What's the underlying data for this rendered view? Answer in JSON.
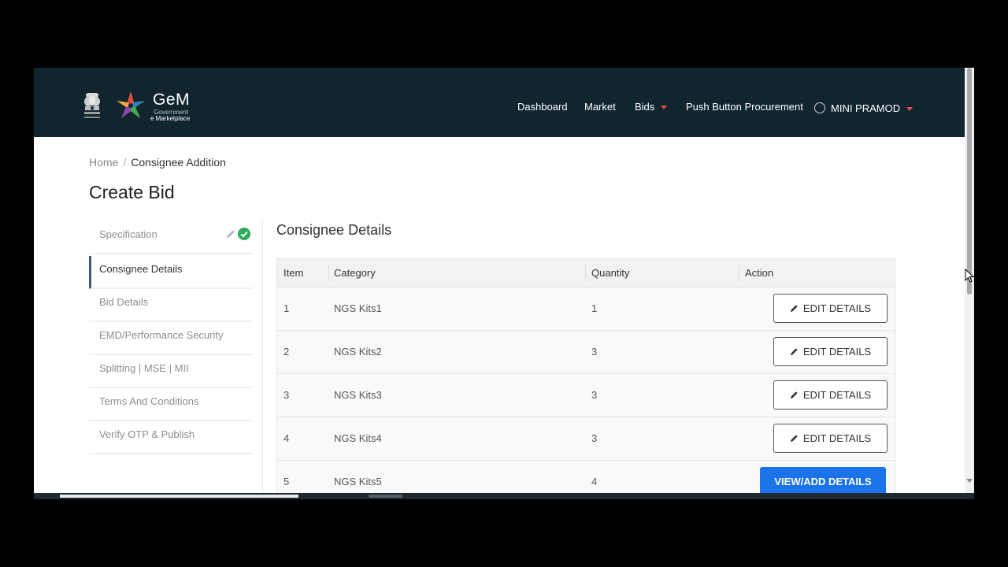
{
  "header": {
    "brand_name": "GeM",
    "brand_sub1": "Government",
    "brand_sub2": "e Marketplace",
    "nav": [
      "Dashboard",
      "Market",
      "Bids",
      "Push Button Procurement"
    ],
    "user_name": "MINI PRAMOD"
  },
  "breadcrumb": {
    "home": "Home",
    "separator": "/",
    "current": "Consignee Addition"
  },
  "page_title": "Create Bid",
  "sidebar": {
    "items": [
      {
        "label": "Specification",
        "status": "complete"
      },
      {
        "label": "Consignee Details",
        "status": "active"
      },
      {
        "label": "Bid Details"
      },
      {
        "label": "EMD/Performance Security"
      },
      {
        "label": "Splitting | MSE | MII"
      },
      {
        "label": "Terms And Conditions"
      },
      {
        "label": "Verify OTP & Publish"
      }
    ]
  },
  "section_title": "Consignee Details",
  "table": {
    "headers": [
      "Item",
      "Category",
      "Quantity",
      "Action"
    ],
    "rows": [
      {
        "item": "1",
        "category": "NGS Kits1",
        "quantity": "1",
        "action": "EDIT DETAILS"
      },
      {
        "item": "2",
        "category": "NGS Kits2",
        "quantity": "3",
        "action": "EDIT DETAILS"
      },
      {
        "item": "3",
        "category": "NGS Kits3",
        "quantity": "3",
        "action": "EDIT DETAILS"
      },
      {
        "item": "4",
        "category": "NGS Kits4",
        "quantity": "3",
        "action": "EDIT DETAILS"
      },
      {
        "item": "5",
        "category": "NGS Kits5",
        "quantity": "4",
        "action": "VIEW/ADD DETAILS"
      }
    ]
  },
  "colors": {
    "header_bg": "#11252f",
    "primary_button": "#1a73e8",
    "check_green": "#2eaa5c",
    "caret_red": "#e54848"
  },
  "icons": [
    "emblem-icon",
    "gem-logo-icon",
    "chevron-down-icon",
    "user-icon",
    "pencil-icon",
    "check-circle-icon"
  ]
}
